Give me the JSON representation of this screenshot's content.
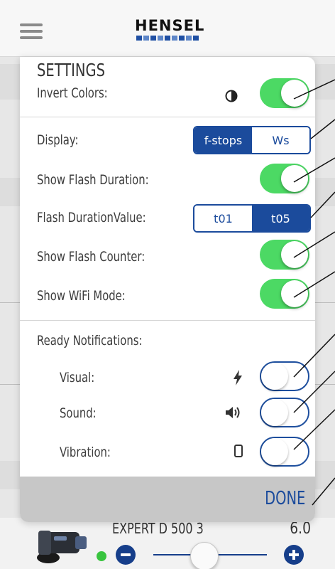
{
  "app": {
    "logo": "HENSEL"
  },
  "device": {
    "name": "EXPERT D 500 3",
    "value": "6.0",
    "power_level": 0.45
  },
  "settings": {
    "title": "SETTINGS",
    "invert_colors": {
      "label": "Invert Colors:",
      "icon": "contrast-icon",
      "on": true
    },
    "display": {
      "label": "Display:",
      "options": [
        "f-stops",
        "Ws"
      ],
      "selected": "f-stops"
    },
    "show_flash_duration": {
      "label": "Show Flash Duration:",
      "on": true
    },
    "flash_duration_value": {
      "label": "Flash DurationValue:",
      "options": [
        "t01",
        "t05"
      ],
      "selected": "t05"
    },
    "show_flash_counter": {
      "label": "Show Flash Counter:",
      "on": true
    },
    "show_wifi_mode": {
      "label": "Show WiFi Mode:",
      "on": true
    },
    "ready_notifications": {
      "label": "Ready Notifications:",
      "visual": {
        "label": "Visual:",
        "icon": "lightning-icon",
        "on": false
      },
      "sound": {
        "label": "Sound:",
        "icon": "speaker-icon",
        "on": false
      },
      "vibration": {
        "label": "Vibration:",
        "icon": "phone-icon",
        "on": false
      }
    },
    "done_label": "DONE"
  },
  "colors": {
    "accent": "#1b4b9c",
    "toggle_on": "#4cd964",
    "status_dot": "#39c43f"
  }
}
